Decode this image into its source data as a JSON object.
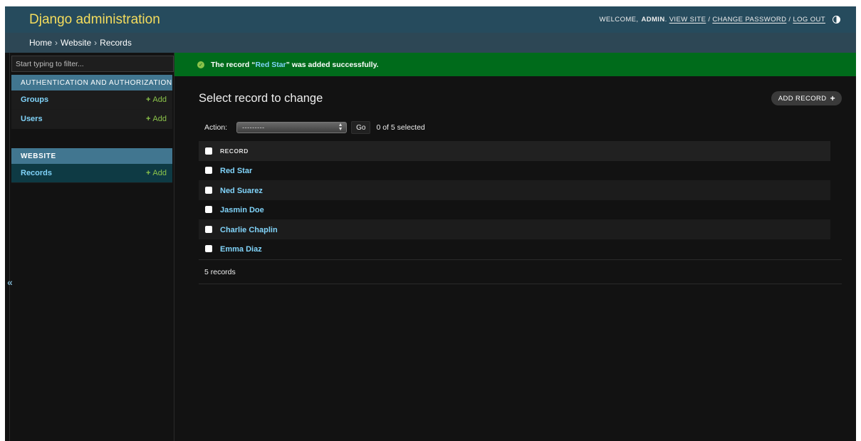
{
  "header": {
    "site_name": "Django administration",
    "welcome": "Welcome,",
    "username": "admin",
    "view_site": "View site",
    "change_password": "Change password",
    "log_out": "Log out",
    "theme_toggle_icon": "half-circle-icon"
  },
  "breadcrumbs": {
    "home": "Home",
    "app": "Website",
    "current": "Records",
    "separator": "›"
  },
  "sidebar": {
    "filter_placeholder": "Start typing to filter...",
    "toggle_label": "«",
    "modules": [
      {
        "caption": "Authentication and Authorization",
        "models": [
          {
            "name": "Groups",
            "add": "Add"
          },
          {
            "name": "Users",
            "add": "Add"
          }
        ]
      },
      {
        "caption": "Website",
        "models": [
          {
            "name": "Records",
            "add": "Add"
          }
        ]
      }
    ]
  },
  "message": {
    "prefix": "The record “",
    "link": "Red Star",
    "suffix": "” was added successfully.",
    "icon": "check-circle-icon"
  },
  "content": {
    "title": "Select record to change",
    "add_button": "Add record",
    "action_label": "Action:",
    "action_select_value": "---------",
    "go_button": "Go",
    "selection_counter": "0 of 5 selected",
    "table": {
      "header": "Record",
      "rows": [
        "Red Star",
        "Ned Suarez",
        "Jasmin Doe",
        "Charlie Chaplin",
        "Emma Diaz"
      ]
    },
    "paginator": "5 records"
  },
  "colors": {
    "header_bg": "#264b5d",
    "site_name": "#f5dd5d",
    "breadcrumbs_bg": "#2d4755",
    "module_caption_bg": "#417690",
    "link": "#81d4fa",
    "add_link": "#8bc34a",
    "success_bg": "#006b1b",
    "page_bg": "#121212"
  }
}
